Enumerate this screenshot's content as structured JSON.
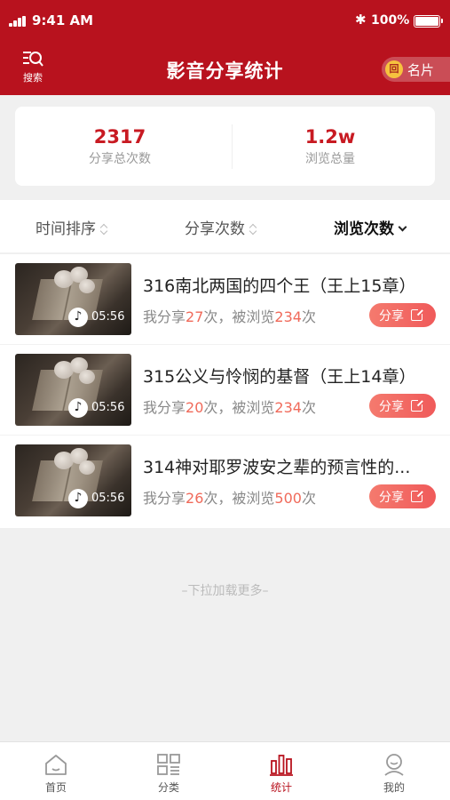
{
  "status_bar": {
    "time": "9:41 AM",
    "battery": "100%"
  },
  "header": {
    "title": "影音分享统计",
    "search_label": "搜索",
    "card_label": "名片",
    "card_badge": "回"
  },
  "summary": [
    {
      "value": "2317",
      "label": "分享总次数"
    },
    {
      "value": "1.2w",
      "label": "浏览总量"
    }
  ],
  "sort_tabs": [
    {
      "label": "时间排序",
      "active": false
    },
    {
      "label": "分享次数",
      "active": false
    },
    {
      "label": "浏览次数",
      "active": true
    }
  ],
  "items": [
    {
      "title": "316南北两国的四个王（王上15章）",
      "duration": "05:56",
      "shares_prefix": "我分享",
      "shares": "27",
      "shares_suffix": "次，被浏览",
      "views": "234",
      "views_suffix": "次",
      "share_label": "分享"
    },
    {
      "title": "315公义与怜悯的基督（王上14章）",
      "duration": "05:56",
      "shares_prefix": "我分享",
      "shares": "20",
      "shares_suffix": "次，被浏览",
      "views": "234",
      "views_suffix": "次",
      "share_label": "分享"
    },
    {
      "title": "314神对耶罗波安之辈的预言性的...",
      "duration": "05:56",
      "shares_prefix": "我分享",
      "shares": "26",
      "shares_suffix": "次，被浏览",
      "views": "500",
      "views_suffix": "次",
      "share_label": "分享"
    }
  ],
  "load_more": "–下拉加载更多–",
  "tabbar": [
    {
      "label": "首页",
      "icon": "home-icon",
      "active": false
    },
    {
      "label": "分类",
      "icon": "category-icon",
      "active": false
    },
    {
      "label": "统计",
      "icon": "stats-icon",
      "active": true
    },
    {
      "label": "我的",
      "icon": "profile-icon",
      "active": false
    }
  ],
  "colors": {
    "brand": "#b8121e",
    "accent": "#f06a5a",
    "summary_value": "#c81a22"
  }
}
